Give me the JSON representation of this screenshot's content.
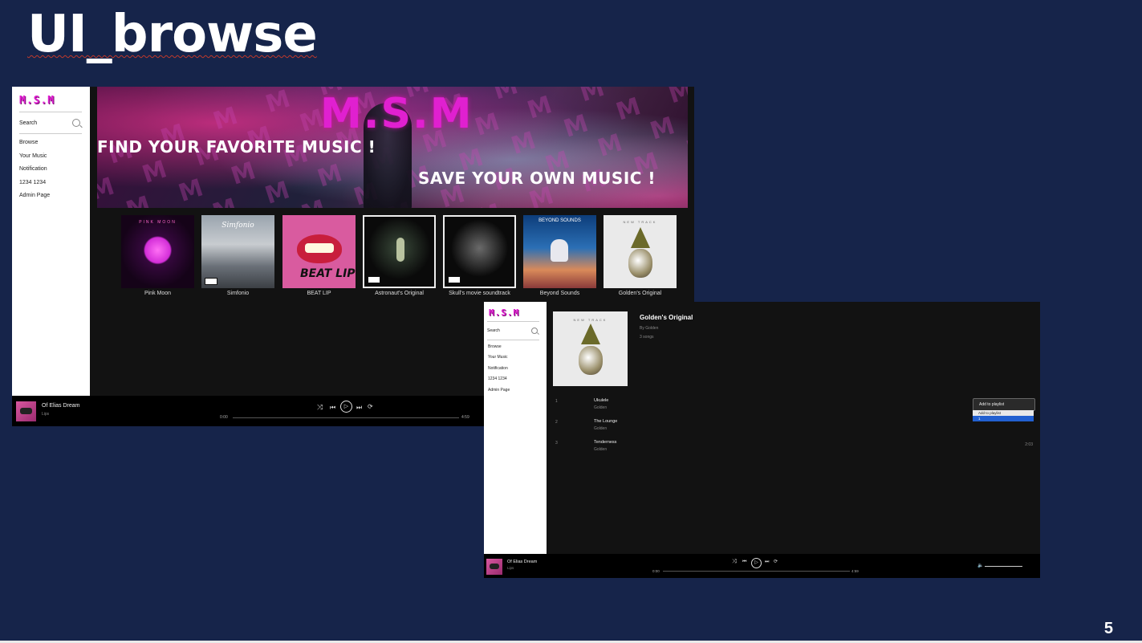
{
  "slide": {
    "title": "UI_browse",
    "page_number": "5"
  },
  "window1": {
    "logo": "M.S.M",
    "search_label": "Search",
    "nav": [
      "Browse",
      "Your Music",
      "Notification",
      "1234 1234",
      "Admin Page"
    ],
    "banner": {
      "logo": "M.S.M",
      "tagline_left": "FIND YOUR FAVORITE MUSIC !",
      "tagline_right": "SAVE YOUR OWN MUSIC !"
    },
    "albums": [
      {
        "title": "Pink Moon",
        "cover_text": "PINK MOON"
      },
      {
        "title": "Simfonio",
        "cover_text": "Simfonio"
      },
      {
        "title": "BEAT LIP",
        "cover_text": "BEAT LIP"
      },
      {
        "title": "Astronaut's Original",
        "cover_text": ""
      },
      {
        "title": "Skull's movie soundtrack",
        "cover_text": ""
      },
      {
        "title": "Beyond Sounds",
        "cover_text": "BEYOND SOUNDS"
      },
      {
        "title": "Golden's Original",
        "cover_text": "NEW TRACK"
      }
    ],
    "player": {
      "title": "Of Elias Dream",
      "artist": "Lips",
      "time_current": "0:00",
      "time_total": "4:59",
      "progress": 0
    }
  },
  "window2": {
    "logo": "M.S.M",
    "search_label": "Search",
    "nav": [
      "Browse",
      "Your Music",
      "Notification",
      "1234 1234",
      "Admin Page"
    ],
    "album": {
      "title": "Golden's Original",
      "by": "By Golden",
      "count": "3 songs",
      "cover_text": "NEW TRACK"
    },
    "songs": [
      {
        "num": "1",
        "title": "Ukulele",
        "artist": "Golden",
        "duration": ""
      },
      {
        "num": "2",
        "title": "The Lounge",
        "artist": "Golden",
        "duration": ""
      },
      {
        "num": "3",
        "title": "Tenderness",
        "artist": "Golden",
        "duration": "2:03"
      }
    ],
    "context_menu": {
      "item": "Add to playlist",
      "submenu_header": "Add to playlist",
      "submenu_item": "1"
    },
    "player": {
      "title": "Of Elias Dream",
      "artist": "Lips",
      "time_current": "0:00",
      "time_total": "4:59",
      "progress": 0
    }
  },
  "icons": {
    "shuffle": "shuffle-icon",
    "prev": "previous-icon",
    "play": "play-icon",
    "next": "next-icon",
    "repeat": "repeat-icon",
    "volume": "volume-icon",
    "search": "search-icon"
  },
  "colors": {
    "background": "#16244a",
    "accent": "#e01fd1",
    "app_bg": "#121212",
    "highlight": "#2260d0"
  }
}
